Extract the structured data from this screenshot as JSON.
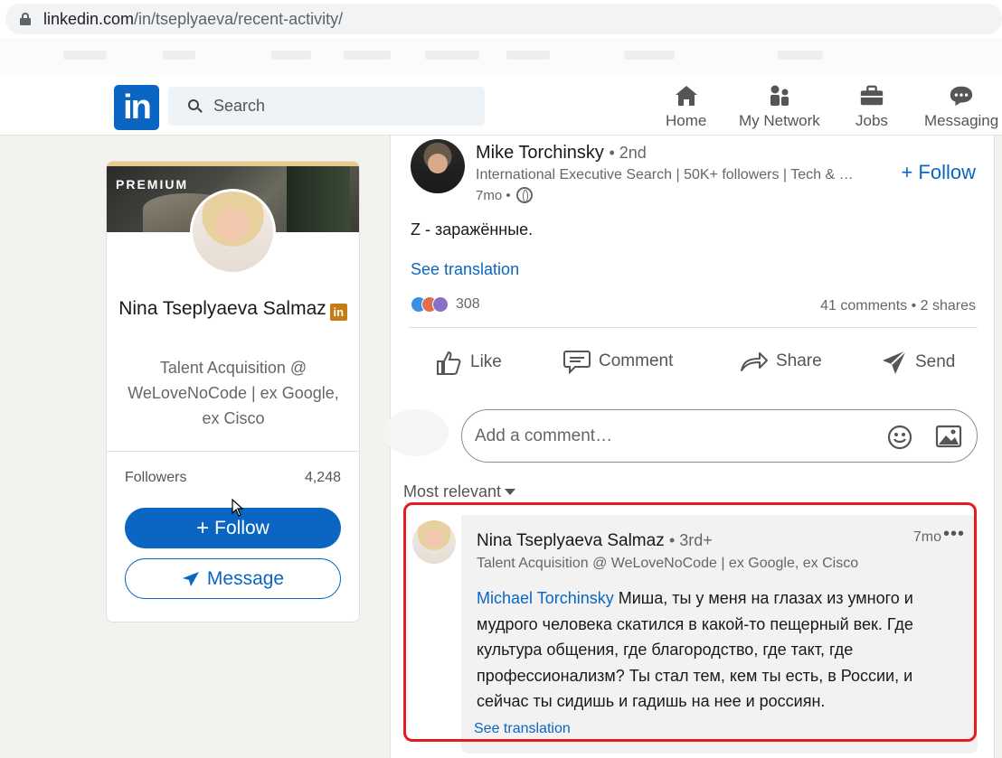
{
  "browser": {
    "url_host": "linkedin.com",
    "url_path": "/in/tseplyaeva/recent-activity/"
  },
  "nav": {
    "logo_text": "in",
    "search_placeholder": "Search",
    "items": [
      {
        "label": "Home",
        "icon": "home-icon"
      },
      {
        "label": "My Network",
        "icon": "network-icon"
      },
      {
        "label": "Jobs",
        "icon": "briefcase-icon"
      },
      {
        "label": "Messaging",
        "icon": "messaging-icon"
      }
    ]
  },
  "profile": {
    "premium_label": "PREMIUM",
    "name": "Nina Tseplyaeva Salmaz",
    "badge": "in",
    "headline": "Talent Acquisition @ WeLoveNoCode | ex Google, ex Cisco",
    "followers_label": "Followers",
    "followers_count": "4,248",
    "follow_label": "Follow",
    "message_label": "Message"
  },
  "post": {
    "author_name": "Mike Torchinsky",
    "author_degree": "• 2nd",
    "author_headline": "International Executive Search | 50K+ followers | Tech & …",
    "time": "7mo •",
    "follow_label": "Follow",
    "text": "Z - заражённые.",
    "see_translation": "See translation",
    "reaction_count": "308",
    "stats": "41 comments • 2 shares",
    "actions": {
      "like": "Like",
      "comment": "Comment",
      "share": "Share",
      "send": "Send"
    },
    "comment_placeholder": "Add a comment…",
    "sort_label": "Most relevant"
  },
  "comment": {
    "author_name": "Nina Tseplyaeva Salmaz",
    "author_degree": "• 3rd+",
    "time": "7mo",
    "more": "•••",
    "headline": "Talent Acquisition @ WeLoveNoCode | ex Google, ex Cisco",
    "mention": "Michael Torchinsky",
    "text": " Миша, ты у меня на глазах из умного и мудрого человека скатился в какой-то пещерный век. Где культура общения, где благородство, где такт, где профессионализм? Ты стал тем, кем ты есть, в России, и сейчас ты сидишь и гадишь на нее и россиян.",
    "see_translation": "See translation"
  },
  "colors": {
    "brand": "#0a66c2",
    "highlight": "#e31b23",
    "premium_badge": "#c37d16"
  }
}
